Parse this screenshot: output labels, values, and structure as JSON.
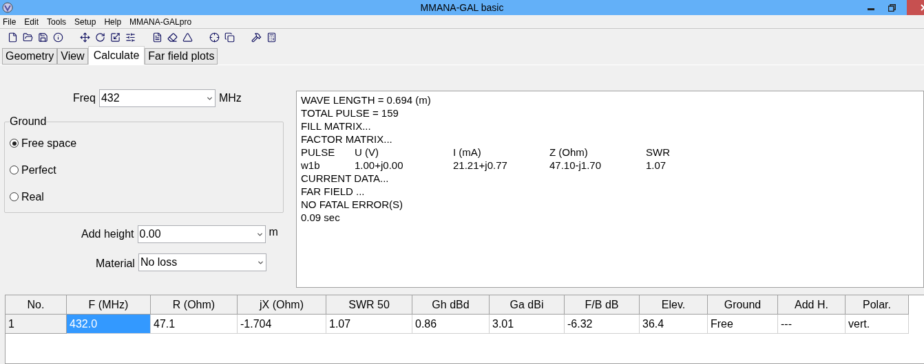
{
  "window": {
    "title": "MMANA-GAL basic"
  },
  "menu": [
    "File",
    "Edit",
    "Tools",
    "Setup",
    "Help",
    "MMANA-GALpro"
  ],
  "tabs": [
    {
      "label": "Geometry",
      "selected": false
    },
    {
      "label": "View",
      "selected": false
    },
    {
      "label": "Calculate",
      "selected": true
    },
    {
      "label": "Far field plots",
      "selected": false
    }
  ],
  "freq": {
    "label": "Freq",
    "value": "432",
    "unit": "MHz"
  },
  "ground": {
    "title": "Ground",
    "options": [
      {
        "label": "Free space",
        "selected": true
      },
      {
        "label": "Perfect",
        "selected": false
      },
      {
        "label": "Real",
        "selected": false
      }
    ]
  },
  "add_height": {
    "label": "Add height",
    "value": "0.00",
    "unit": "m"
  },
  "material": {
    "label": "Material",
    "value": "No loss"
  },
  "output": [
    {
      "kind": "text",
      "text": "WAVE LENGTH = 0.694 (m)"
    },
    {
      "kind": "text",
      "text": "TOTAL PULSE = 159"
    },
    {
      "kind": "text",
      "text": "FILL MATRIX..."
    },
    {
      "kind": "text",
      "text": "FACTOR MATRIX..."
    },
    {
      "kind": "columns",
      "cells": [
        "PULSE",
        "U (V)",
        "I (mA)",
        "Z (Ohm)",
        "SWR"
      ]
    },
    {
      "kind": "columns",
      "cells": [
        "w1b",
        "1.00+j0.00",
        "21.21+j0.77",
        "47.10-j1.70",
        "1.07"
      ]
    },
    {
      "kind": "text",
      "text": "CURRENT DATA..."
    },
    {
      "kind": "text",
      "text": "FAR FIELD ..."
    },
    {
      "kind": "text",
      "text": "NO FATAL ERROR(S)"
    },
    {
      "kind": "text",
      "text": "0.09 sec"
    }
  ],
  "table": {
    "columns": [
      "No.",
      "F (MHz)",
      "R (Ohm)",
      "jX (Ohm)",
      "SWR 50",
      "Gh dBd",
      "Ga dBi",
      "F/B dB",
      "Elev.",
      "Ground",
      "Add H.",
      "Polar."
    ],
    "rows": [
      {
        "cells": [
          {
            "text": "1",
            "selected": false
          },
          {
            "text": "432.0",
            "selected": true
          },
          {
            "text": "47.1",
            "selected": false
          },
          {
            "text": "-1.704",
            "selected": false
          },
          {
            "text": "1.07",
            "selected": false
          },
          {
            "text": "0.86",
            "selected": false
          },
          {
            "text": "3.01",
            "selected": false
          },
          {
            "text": "-6.32",
            "selected": false
          },
          {
            "text": "36.4",
            "selected": false
          },
          {
            "text": "Free",
            "selected": false
          },
          {
            "text": "---",
            "selected": false
          },
          {
            "text": "vert.",
            "selected": false
          }
        ]
      }
    ]
  }
}
